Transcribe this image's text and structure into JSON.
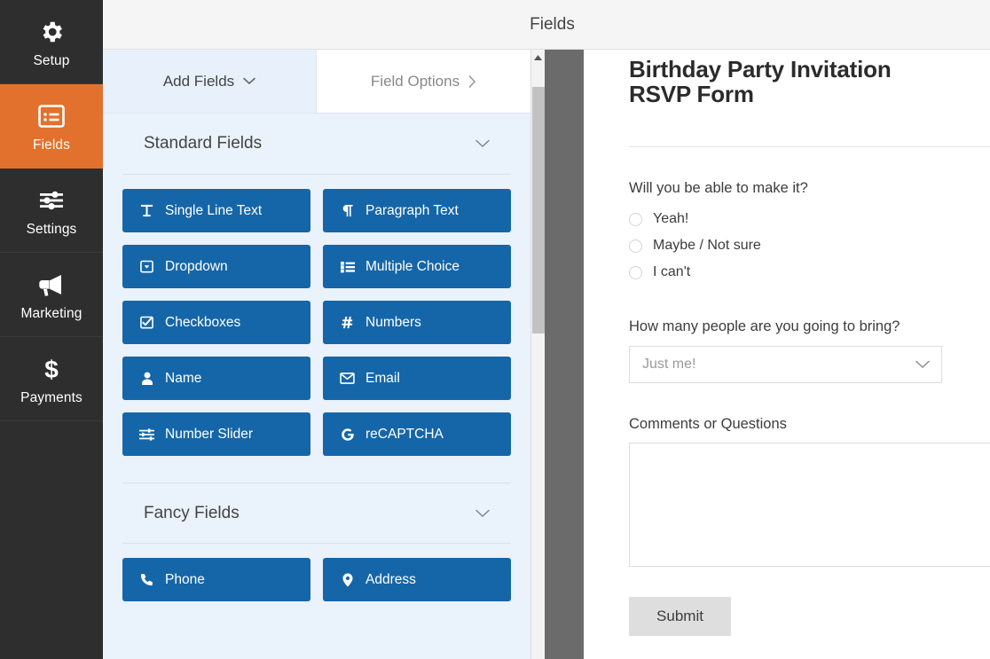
{
  "header": {
    "title": "Fields"
  },
  "sidebar": {
    "active": "Fields",
    "items": [
      {
        "label": "Setup",
        "icon": "gear-icon"
      },
      {
        "label": "Fields",
        "icon": "list-panel-icon"
      },
      {
        "label": "Settings",
        "icon": "sliders-icon"
      },
      {
        "label": "Marketing",
        "icon": "megaphone-icon"
      },
      {
        "label": "Payments",
        "icon": "dollar-icon"
      }
    ]
  },
  "tabs": [
    {
      "label": "Add Fields",
      "icon": "chevron-down-icon",
      "active": true
    },
    {
      "label": "Field Options",
      "icon": "chevron-right-icon",
      "active": false
    }
  ],
  "sections": [
    {
      "title": "Standard Fields",
      "toggle_icon": "chevron-down-icon",
      "fields": [
        {
          "label": "Single Line Text",
          "icon": "text-cursor-icon"
        },
        {
          "label": "Paragraph Text",
          "icon": "pilcrow-icon"
        },
        {
          "label": "Dropdown",
          "icon": "dropdown-icon"
        },
        {
          "label": "Multiple Choice",
          "icon": "radio-list-icon"
        },
        {
          "label": "Checkboxes",
          "icon": "checkbox-icon"
        },
        {
          "label": "Numbers",
          "icon": "hash-icon"
        },
        {
          "label": "Name",
          "icon": "user-icon"
        },
        {
          "label": "Email",
          "icon": "envelope-icon"
        },
        {
          "label": "Number Slider",
          "icon": "slider-icon"
        },
        {
          "label": "reCAPTCHA",
          "icon": "google-g-icon"
        }
      ]
    },
    {
      "title": "Fancy Fields",
      "toggle_icon": "chevron-down-icon",
      "fields": [
        {
          "label": "Phone",
          "icon": "phone-icon"
        },
        {
          "label": "Address",
          "icon": "map-pin-icon"
        }
      ]
    }
  ],
  "form_preview": {
    "title": "Birthday Party Invitation RSVP Form",
    "questions": [
      {
        "label": "Will you be able to make it?",
        "type": "radio",
        "options": [
          "Yeah!",
          "Maybe / Not sure",
          "I can't"
        ]
      },
      {
        "label": "How many people are you going to bring?",
        "type": "select",
        "value": "Just me!",
        "icon": "chevron-down-icon"
      },
      {
        "label": "Comments or Questions",
        "type": "textarea",
        "value": ""
      }
    ],
    "submit_label": "Submit"
  },
  "colors": {
    "sidebar_bg": "#2e2e2e",
    "sidebar_active": "#e2712d",
    "field_button": "#1566a8",
    "panel_bg": "#eaf2fb",
    "gutter": "#6b6b6b",
    "submit_bg": "#dedede"
  }
}
